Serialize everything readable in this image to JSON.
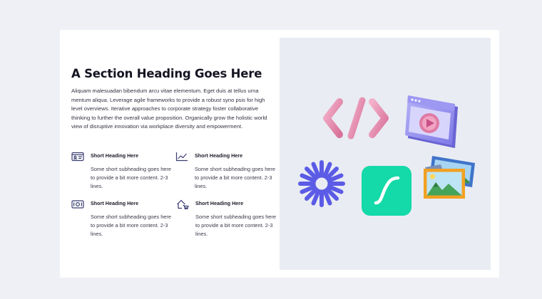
{
  "section": {
    "heading": "A Section Heading Goes Here",
    "paragraph": "Aliquam malesuadan bibendum arcu vitae elementum. Eget duis at tellus urna mentum aliqua. Leverage agile frameworks to provide a robust syno psis for high level overviews. Iterative approaches to corporate strategy foster collaborative thinking to further the overall value proposition. Organically grow the holistic world view of disruptive innovation via workplace diversity and empowerment."
  },
  "features": [
    {
      "icon": "id-card-icon",
      "title": "Short Heading Here",
      "description": "Some short subheading goes here to provide a bit more content. 2-3 lines."
    },
    {
      "icon": "line-chart-icon",
      "title": "Short Heading Here",
      "description": "Some short subheading goes here to provide a bit more content. 2-3 lines."
    },
    {
      "icon": "banknote-icon",
      "title": "Short Heading Here",
      "description": "Some short subheading goes here to provide a bit more content. 2-3 lines."
    },
    {
      "icon": "house-cart-icon",
      "title": "Short Heading Here",
      "description": "Some short subheading goes here to provide a bit more content. 2-3 lines."
    }
  ],
  "illustrations": [
    "code-brackets-icon",
    "video-window-icon",
    "asterisk-burst-icon",
    "curve-app-icon",
    "photo-frames-icon"
  ],
  "colors": {
    "page_background": "#eef0f5",
    "card_background": "#ffffff",
    "media_panel": "#e9ecf3",
    "heading": "#151522",
    "body_text": "#333342",
    "icon_stroke": "#3b3e72",
    "pink": "#e98fb2",
    "purple": "#8f8cf0",
    "indigo_burst": "#5b5be6",
    "mint": "#14d9a8",
    "orange_frame": "#f2a123",
    "blue_frame": "#3f74c9"
  }
}
